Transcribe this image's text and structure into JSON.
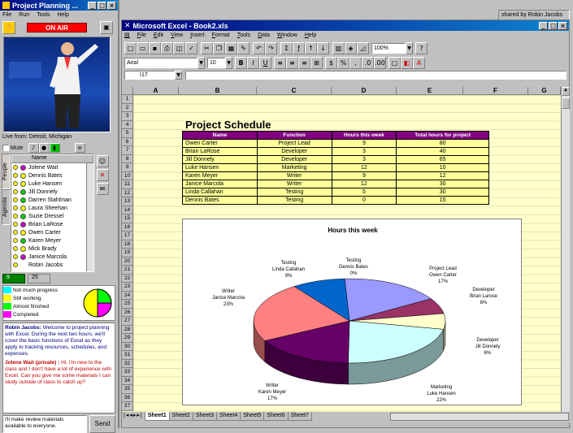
{
  "shared_by": "shared by Robin Jacobs",
  "pp": {
    "title": "Project Planning ...",
    "menu": [
      "File",
      "Run",
      "Tools",
      "Help"
    ],
    "on_air": "ON AIR",
    "live_from": "Live from: Detroit, Michigan",
    "mute": "Mute",
    "tabs": [
      "People",
      "Agenda"
    ],
    "col_name": "Name",
    "participants": [
      {
        "name": "Jolene Wait",
        "dot": "#cc00cc"
      },
      {
        "name": "Dennis Bates",
        "dot": "#ffff00"
      },
      {
        "name": "Luke Hansen",
        "dot": "#ffff00"
      },
      {
        "name": "Jill Donnely",
        "dot": "#00cc00"
      },
      {
        "name": "Darren Stahlman",
        "dot": "#00cc00"
      },
      {
        "name": "Laura Sheehan",
        "dot": "#ffff00"
      },
      {
        "name": "Suzie Dressel",
        "dot": "#00cc00"
      },
      {
        "name": "Brian LaRose",
        "dot": "#cc00cc"
      },
      {
        "name": "Owen Carter",
        "dot": "#ffff00"
      },
      {
        "name": "Karen Meyer",
        "dot": "#00cc00"
      },
      {
        "name": "Mick Brady",
        "dot": "#ffff00"
      },
      {
        "name": "Janice Marcola",
        "dot": "#cc00cc"
      },
      {
        "name": "Robin Jacobs",
        "dot": ""
      }
    ],
    "count_a": "9",
    "count_b": "25",
    "legend": [
      {
        "label": "Not much progress",
        "color": "#00ffff"
      },
      {
        "label": "Still working",
        "color": "#ffff00"
      },
      {
        "label": "Almost finished",
        "color": "#00ff00"
      },
      {
        "label": "Completed",
        "color": "#ff00ff"
      }
    ],
    "chat": [
      {
        "who": "Robin Jacobs:",
        "msg": "Welcome to project planning with Excel. During the next two hours, we'll cover the basic functions of Excel as they apply to tracking resources, schedules, and expenses."
      },
      {
        "who": "Jolene Wait (private) :",
        "msg": "Hi, I'm new to the class and I don't have a lot of experience with Excel. Can you give me some materials I can study outside of class to catch up?"
      }
    ],
    "input_text": "I'll make review materials available to everyone.",
    "send": "Send"
  },
  "excel": {
    "title": "Microsoft Excel - Book2.xls",
    "menu": [
      "File",
      "Edit",
      "View",
      "Insert",
      "Format",
      "Tools",
      "Data",
      "Window",
      "Help"
    ],
    "zoom": "100%",
    "font": "Arial",
    "size": "10",
    "cell_ref": "I17",
    "col_headers": [
      "A",
      "B",
      "C",
      "D",
      "E",
      "F",
      "G"
    ],
    "sheet_title": "Project Schedule",
    "table_headers": [
      "Name",
      "Function",
      "Hours this week",
      "Total hours for project"
    ],
    "rows": [
      [
        "Owen Carter",
        "Project Lead",
        "9",
        "80"
      ],
      [
        "Brian LaRose",
        "Developer",
        "3",
        "40"
      ],
      [
        "Jill Donnely",
        "Developer",
        "3",
        "65"
      ],
      [
        "Luke Hansen",
        "Marketing",
        "12",
        "10"
      ],
      [
        "Karen Meyer",
        "Writer",
        "9",
        "12"
      ],
      [
        "Janice Marcola",
        "Writer",
        "12",
        "30"
      ],
      [
        "Linda Callahan",
        "Testing",
        "5",
        "30"
      ],
      [
        "Dennis Bates",
        "Testing",
        "0",
        "15"
      ]
    ],
    "sheet_tabs": [
      "Sheet1",
      "Sheet2",
      "Sheet3",
      "Sheet4",
      "Sheet5",
      "Sheet6",
      "Sheet7"
    ]
  },
  "chart_data": {
    "type": "pie",
    "title": "Hours this week",
    "slices": [
      {
        "role": "Project Lead",
        "name": "Owen Carter",
        "pct": "17%",
        "value": 17,
        "color": "#9999ff"
      },
      {
        "role": "Developer",
        "name": "Brian Larose",
        "pct": "6%",
        "value": 6,
        "color": "#993366"
      },
      {
        "role": "Developer",
        "name": "Jill Donnely",
        "pct": "6%",
        "value": 6,
        "color": "#ffffcc"
      },
      {
        "role": "Marketing",
        "name": "Luke Hansen",
        "pct": "22%",
        "value": 22,
        "color": "#ccffff"
      },
      {
        "role": "Writer",
        "name": "Karen Meyer",
        "pct": "17%",
        "value": 17,
        "color": "#660066"
      },
      {
        "role": "Writer",
        "name": "Janice Marcola",
        "pct": "23%",
        "value": 23,
        "color": "#ff8080"
      },
      {
        "role": "Testing",
        "name": "Linda Callahan",
        "pct": "9%",
        "value": 9,
        "color": "#0066cc"
      },
      {
        "role": "Testing",
        "name": "Dennis Bates",
        "pct": "0%",
        "value": 0,
        "color": "#ccccff"
      }
    ]
  }
}
